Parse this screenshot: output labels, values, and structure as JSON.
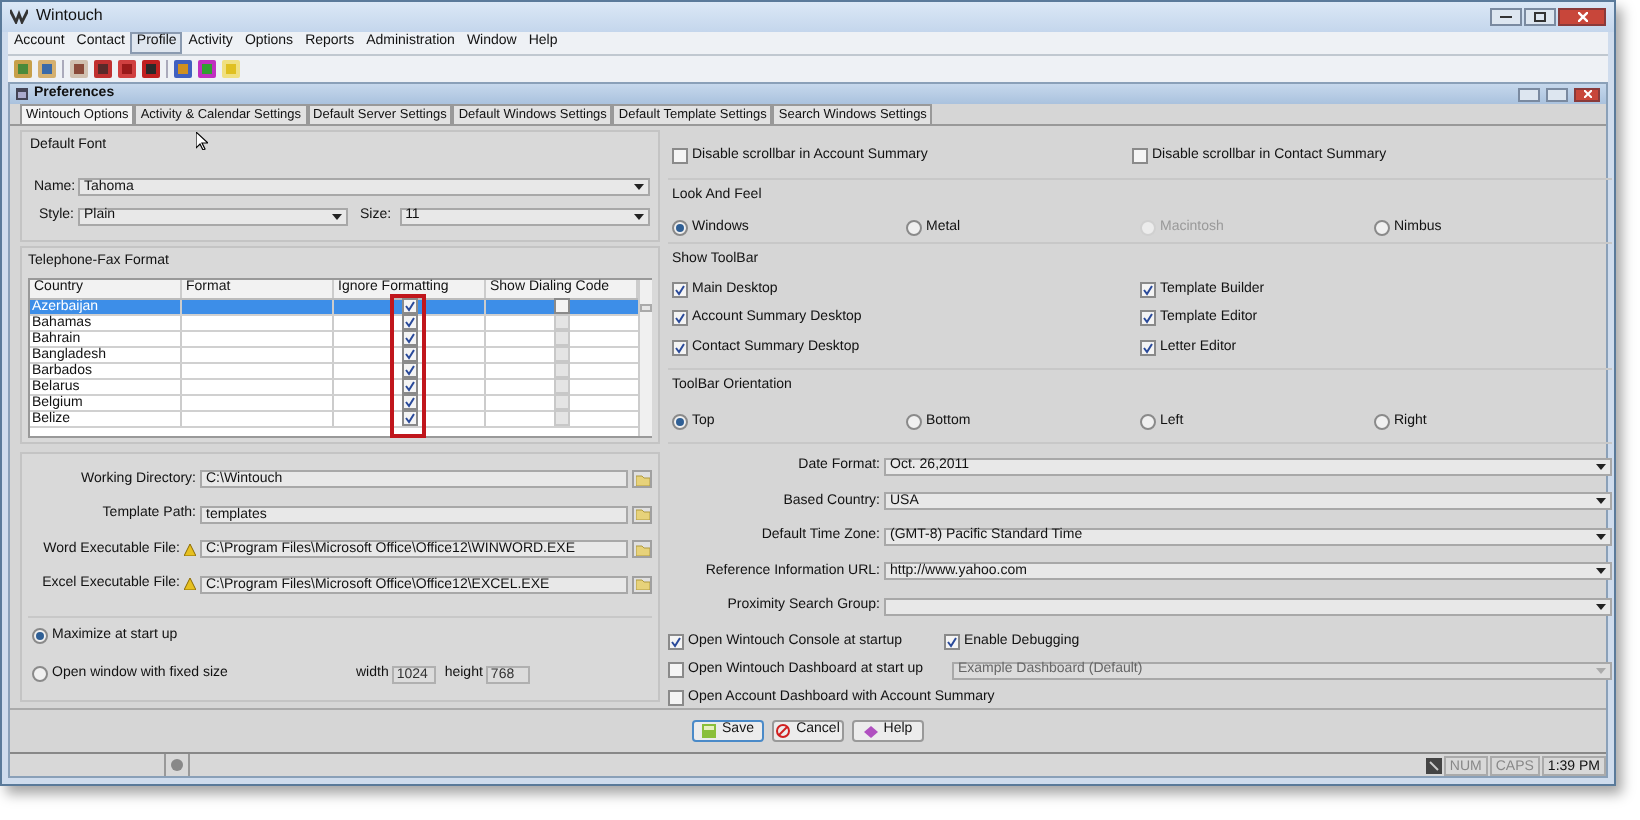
{
  "window": {
    "title": "Wintouch"
  },
  "menu": [
    {
      "label": "Account",
      "selected": false
    },
    {
      "label": "Contact",
      "selected": false
    },
    {
      "label": "Profile",
      "selected": true
    },
    {
      "label": "Activity",
      "selected": false
    },
    {
      "label": "Options",
      "selected": false
    },
    {
      "label": "Reports",
      "selected": false
    },
    {
      "label": "Administration",
      "selected": false
    },
    {
      "label": "Window",
      "selected": false
    },
    {
      "label": "Help",
      "selected": false
    }
  ],
  "preferences": {
    "title": "Preferences"
  },
  "tabs": [
    {
      "label": "Wintouch Options",
      "selected": true
    },
    {
      "label": "Activity & Calendar Settings",
      "selected": false
    },
    {
      "label": "Default Server Settings",
      "selected": false
    },
    {
      "label": "Default Windows Settings",
      "selected": false
    },
    {
      "label": "Default Template Settings",
      "selected": false
    },
    {
      "label": "Search Windows Settings",
      "selected": false
    }
  ],
  "default_font": {
    "title": "Default Font",
    "name": {
      "label": "Name:",
      "value": "Tahoma"
    },
    "style": {
      "label": "Style:",
      "value": "Plain"
    },
    "size": {
      "label": "Size:",
      "value": "11"
    }
  },
  "phone_format": {
    "title": "Telephone-Fax Format",
    "columns": [
      "Country",
      "Format",
      "Ignore Formatting",
      "Show Dialing Code"
    ],
    "rows": [
      {
        "country": "Azerbaijan",
        "selected": true,
        "ignore_formatting": true,
        "show_dialing_code": false,
        "dialing_disabled": false
      },
      {
        "country": "Bahamas",
        "selected": false,
        "ignore_formatting": true,
        "show_dialing_code": false,
        "dialing_disabled": true
      },
      {
        "country": "Bahrain",
        "selected": false,
        "ignore_formatting": true,
        "show_dialing_code": false,
        "dialing_disabled": true
      },
      {
        "country": "Bangladesh",
        "selected": false,
        "ignore_formatting": true,
        "show_dialing_code": false,
        "dialing_disabled": true
      },
      {
        "country": "Barbados",
        "selected": false,
        "ignore_formatting": true,
        "show_dialing_code": false,
        "dialing_disabled": true
      },
      {
        "country": "Belarus",
        "selected": false,
        "ignore_formatting": true,
        "show_dialing_code": false,
        "dialing_disabled": true
      },
      {
        "country": "Belgium",
        "selected": false,
        "ignore_formatting": true,
        "show_dialing_code": false,
        "dialing_disabled": true
      },
      {
        "country": "Belize",
        "selected": false,
        "ignore_formatting": true,
        "show_dialing_code": false,
        "dialing_disabled": true
      }
    ]
  },
  "paths": [
    {
      "label": "Working Directory:",
      "value": "C:\\Wintouch",
      "warning": false
    },
    {
      "label": "Template Path:",
      "value": "templates",
      "warning": false
    },
    {
      "label": "Word Executable File:",
      "value": "C:\\Program Files\\Microsoft Office\\Office12\\WINWORD.EXE",
      "warning": true
    },
    {
      "label": "Excel Executable File:",
      "value": "C:\\Program Files\\Microsoft Office\\Office12\\EXCEL.EXE",
      "warning": true
    }
  ],
  "startup": {
    "options": [
      {
        "label": "Maximize at start up",
        "selected": true
      },
      {
        "label": "Open window with fixed size",
        "selected": false
      }
    ],
    "width": {
      "label": "width",
      "value": "1024"
    },
    "height": {
      "label": "height",
      "value": "768"
    }
  },
  "scrollbar_options": [
    {
      "label": "Disable scrollbar in Account Summary",
      "checked": false
    },
    {
      "label": "Disable scrollbar in Contact Summary",
      "checked": false
    }
  ],
  "look_and_feel": {
    "title": "Look And Feel",
    "options": [
      {
        "label": "Windows",
        "selected": true,
        "disabled": false
      },
      {
        "label": "Metal",
        "selected": false,
        "disabled": false
      },
      {
        "label": "Macintosh",
        "selected": false,
        "disabled": true
      },
      {
        "label": "Nimbus",
        "selected": false,
        "disabled": false
      }
    ]
  },
  "show_toolbar": {
    "title": "Show ToolBar",
    "items": [
      {
        "label": "Main Desktop",
        "checked": true
      },
      {
        "label": "Account Summary Desktop",
        "checked": true
      },
      {
        "label": "Contact Summary Desktop",
        "checked": true
      },
      {
        "label": "Template Builder",
        "checked": true
      },
      {
        "label": "Template Editor",
        "checked": true
      },
      {
        "label": "Letter Editor",
        "checked": true
      }
    ]
  },
  "toolbar_orientation": {
    "title": "ToolBar Orientation",
    "options": [
      {
        "label": "Top",
        "selected": true
      },
      {
        "label": "Bottom",
        "selected": false
      },
      {
        "label": "Left",
        "selected": false
      },
      {
        "label": "Right",
        "selected": false
      }
    ]
  },
  "settings": [
    {
      "label": "Date Format:",
      "value": "Oct. 26,2011"
    },
    {
      "label": "Based Country:",
      "value": "USA"
    },
    {
      "label": "Default Time Zone:",
      "value": "(GMT-8) Pacific Standard Time"
    },
    {
      "label": "Reference Information URL:",
      "value": "http://www.yahoo.com"
    },
    {
      "label": "Proximity Search Group:"
    }
  ],
  "console": {
    "open_console": {
      "label": "Open Wintouch Console at startup",
      "checked": true
    },
    "enable_debugging": {
      "label": "Enable Debugging",
      "checked": true
    },
    "open_dashboard": {
      "label": "Open Wintouch Dashboard at start up",
      "checked": false,
      "value": "Example Dashboard (Default)"
    },
    "open_account_dashboard": {
      "label": "Open Account Dashboard with Account Summary",
      "checked": false
    }
  },
  "buttons": [
    {
      "kind": "save",
      "label": "Save"
    },
    {
      "kind": "cancel",
      "label": "Cancel"
    },
    {
      "kind": "help",
      "label": "Help"
    }
  ],
  "status_bar": [
    "NUM",
    "CAPS",
    "1:39 PM"
  ]
}
